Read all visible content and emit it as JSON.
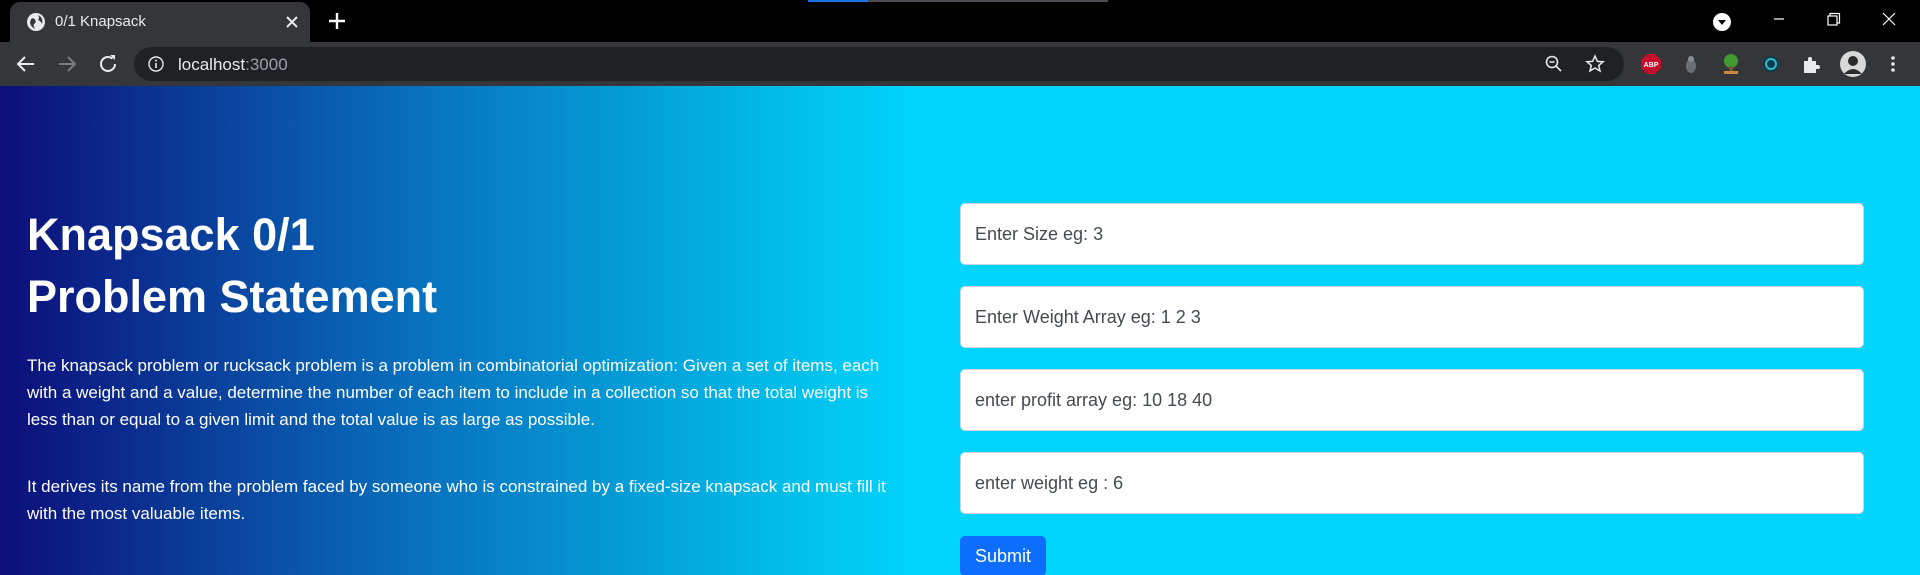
{
  "browser": {
    "tab_title": "0/1 Knapsack",
    "url_host": "localhost",
    "url_port": ":3000",
    "extensions": [
      {
        "name": "adblock-plus-icon",
        "label": "ABP"
      },
      {
        "name": "extension-gray-icon"
      },
      {
        "name": "extension-tree-icon"
      },
      {
        "name": "extension-teal-icon"
      },
      {
        "name": "extensions-puzzle-icon"
      }
    ]
  },
  "page": {
    "heading_line1": "Knapsack 0/1",
    "heading_line2": "Problem Statement",
    "paragraph1": "The knapsack problem or rucksack problem is a problem in combinatorial optimization: Given a set of items, each with a weight and a value, determine the number of each item to include in a collection so that the total weight is less than or equal to a given limit and the total value is as large as possible.",
    "paragraph2": "It derives its name from the problem faced by someone who is constrained by a fixed-size knapsack and must fill it with the most valuable items.",
    "form": {
      "size_placeholder": "Enter Size eg: 3",
      "weights_placeholder": "Enter Weight Array eg: 1 2 3",
      "profits_placeholder": "enter profit array eg: 10 18 40",
      "capacity_placeholder": "enter weight eg : 6",
      "submit_label": "Submit"
    }
  },
  "colors": {
    "gradient_start": "#0c0e7a",
    "gradient_end": "#00d4ff",
    "button": "#0d6efd"
  }
}
